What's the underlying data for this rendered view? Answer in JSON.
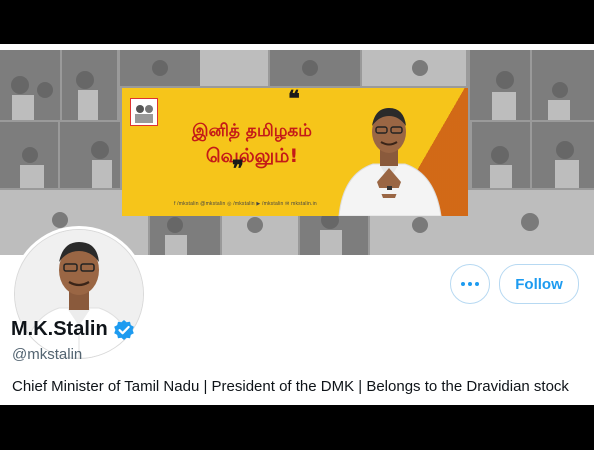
{
  "profile": {
    "name": "M.K.Stalin",
    "handle": "@mkstalin",
    "bio": "Chief Minister of Tamil Nadu | President of the DMK | Belongs to the Dravidian stock",
    "verified": true
  },
  "actions": {
    "more_icon": "more-horizontal-icon",
    "follow_label": "Follow"
  },
  "banner": {
    "quote_open": "❝",
    "quote_close": "❞",
    "slogan_line1": "இனித் தமிழகம்",
    "slogan_line2": "வெல்லும்!",
    "handles": "f /mkstalin   @mkstalin   ◎ /mkstalin   ▶ /mkstalin   ✉ mkstalin.in"
  },
  "colors": {
    "accent": "#1d9bf0",
    "banner_yellow": "#f6c51a",
    "slogan_red": "#c41a18",
    "text_primary": "#0f1419",
    "text_secondary": "#536471"
  }
}
